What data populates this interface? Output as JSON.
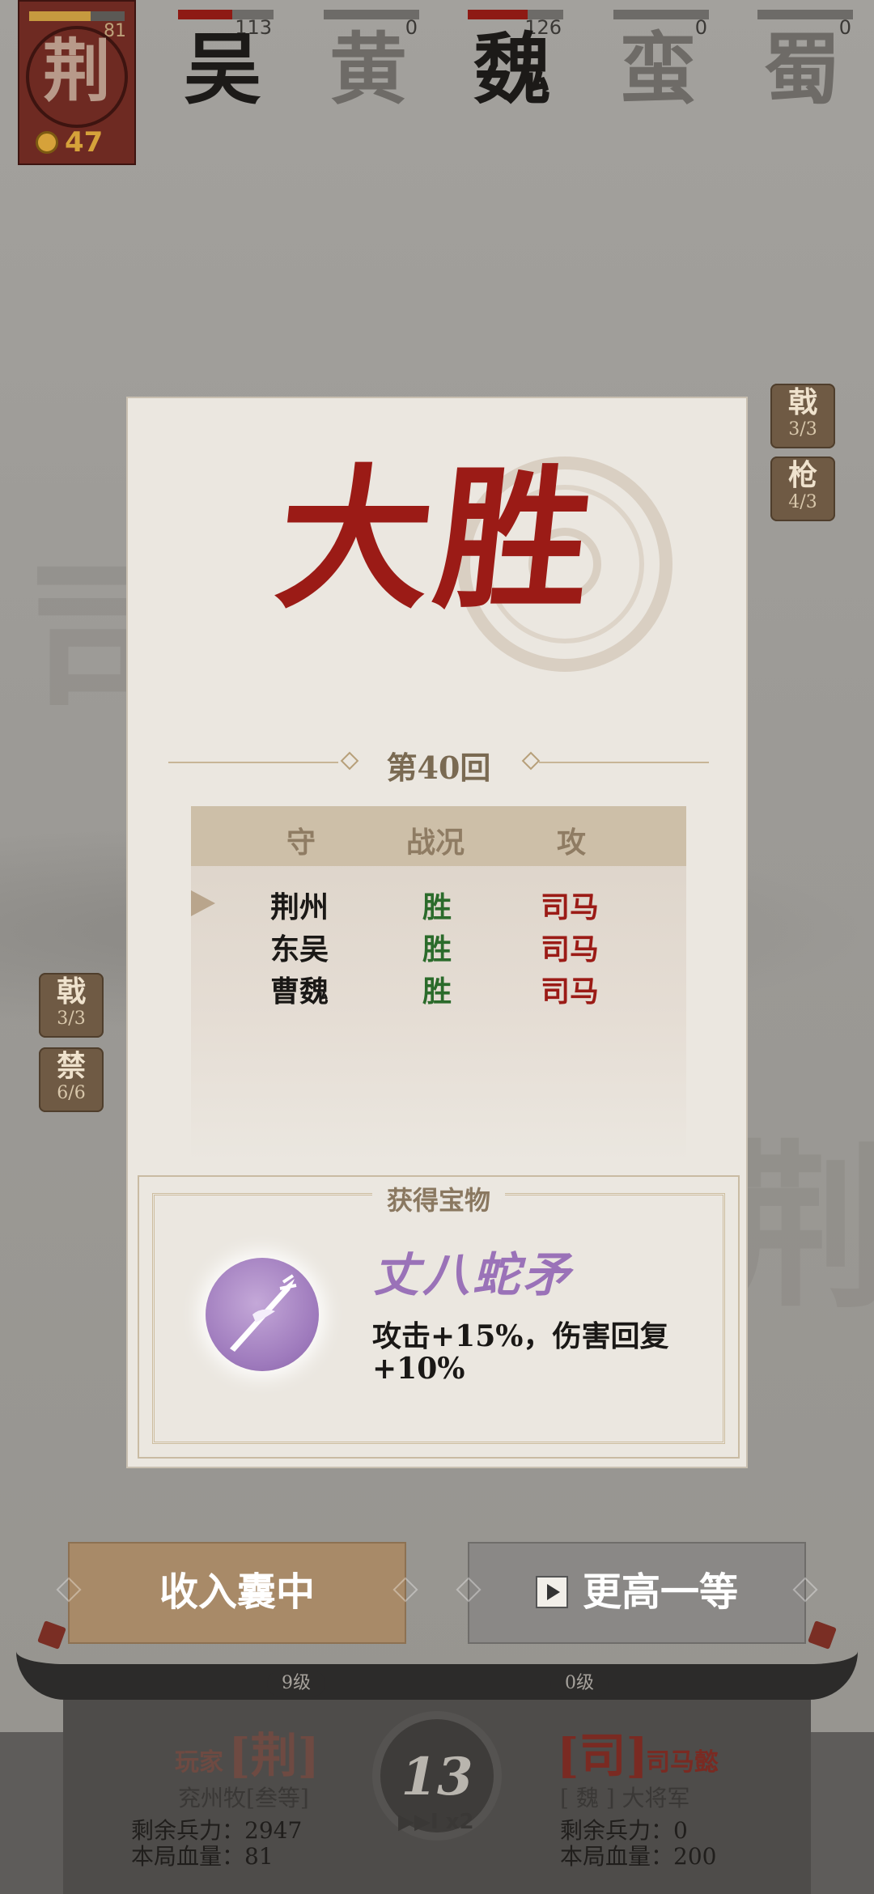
{
  "factions": [
    {
      "name": "荆",
      "hp": "81",
      "gold": "47",
      "player": true
    },
    {
      "name": "吴",
      "hp": "113"
    },
    {
      "name": "黄",
      "hp": "0"
    },
    {
      "name": "魏",
      "hp": "126"
    },
    {
      "name": "蛮",
      "hp": "0"
    },
    {
      "name": "蜀",
      "hp": "0"
    }
  ],
  "right_skills": [
    {
      "name": "戟",
      "count": "3/3"
    },
    {
      "name": "枪",
      "count": "4/3"
    }
  ],
  "left_skills": [
    {
      "name": "戟",
      "count": "3/3"
    },
    {
      "name": "禁",
      "count": "6/6"
    }
  ],
  "dialog": {
    "title": "大胜",
    "round": "第40回",
    "table_headers": {
      "defend": "守",
      "result": "战况",
      "attack": "攻"
    },
    "rows": [
      {
        "defender": "荆州",
        "result": "胜",
        "attacker": "司马"
      },
      {
        "defender": "东吴",
        "result": "胜",
        "attacker": "司马"
      },
      {
        "defender": "曹魏",
        "result": "胜",
        "attacker": "司马"
      }
    ],
    "treasure_caption": "获得宝物",
    "treasure_name": "丈八蛇矛",
    "treasure_desc": "攻击+15%，伤害回复+10%"
  },
  "buttons": {
    "collect": "收入囊中",
    "upgrade": "更高一等"
  },
  "hud": {
    "left_level": "9级",
    "right_level": "0级",
    "player_label": "玩家",
    "player_faction": "[荆]",
    "player_title": "兖州牧[叁等]",
    "player_troops": "剩余兵力：2947",
    "player_hp": "本局血量：81",
    "enemy_faction": "[司]",
    "enemy_name": "司马懿",
    "enemy_title": "[ 魏 ] 大将军",
    "enemy_troops": "剩余兵力：0",
    "enemy_hp": "本局血量：200",
    "round_number": "13",
    "speed": "▶▶I x2"
  },
  "colors": {
    "victory_red": "#9b1b16",
    "win_green": "#2b6b2b",
    "treasure_purple": "#9a72b8",
    "collect_button": "#a88a68",
    "upgrade_button": "#8a8886"
  }
}
